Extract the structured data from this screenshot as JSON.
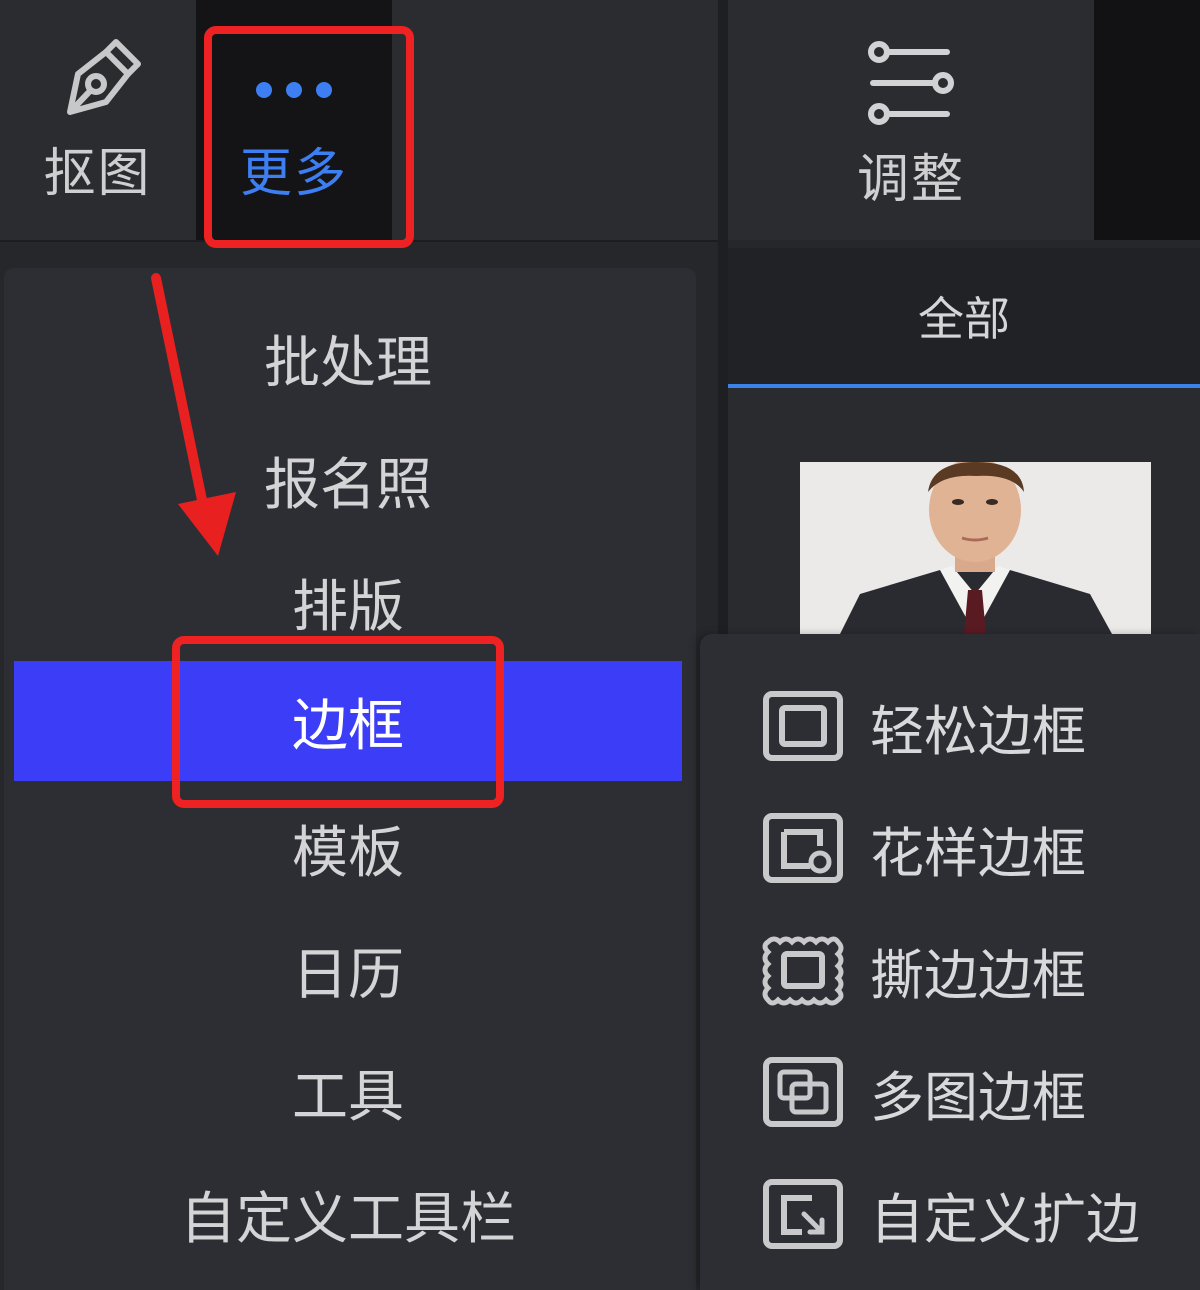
{
  "toolbar": {
    "cutout_label": "抠图",
    "more_label": "更多",
    "adjust_label": "调整"
  },
  "right_panel": {
    "tab_label": "全部"
  },
  "menu": {
    "items": [
      {
        "label": "批处理"
      },
      {
        "label": "报名照"
      },
      {
        "label": "排版"
      },
      {
        "label": "边框"
      },
      {
        "label": "模板"
      },
      {
        "label": "日历"
      },
      {
        "label": "工具"
      },
      {
        "label": "自定义工具栏"
      }
    ],
    "active_index": 3
  },
  "submenu": {
    "items": [
      {
        "label": "轻松边框",
        "icon": "simple-frame-icon"
      },
      {
        "label": "花样边框",
        "icon": "pattern-frame-icon"
      },
      {
        "label": "撕边边框",
        "icon": "torn-edge-frame-icon"
      },
      {
        "label": "多图边框",
        "icon": "multi-image-frame-icon"
      },
      {
        "label": "自定义扩边",
        "icon": "custom-expand-icon"
      }
    ]
  },
  "colors": {
    "accent_blue": "#3b82e8",
    "active_item": "#3b3df7",
    "annotation_red": "#ee2222",
    "arrow_red": "#e82020"
  }
}
